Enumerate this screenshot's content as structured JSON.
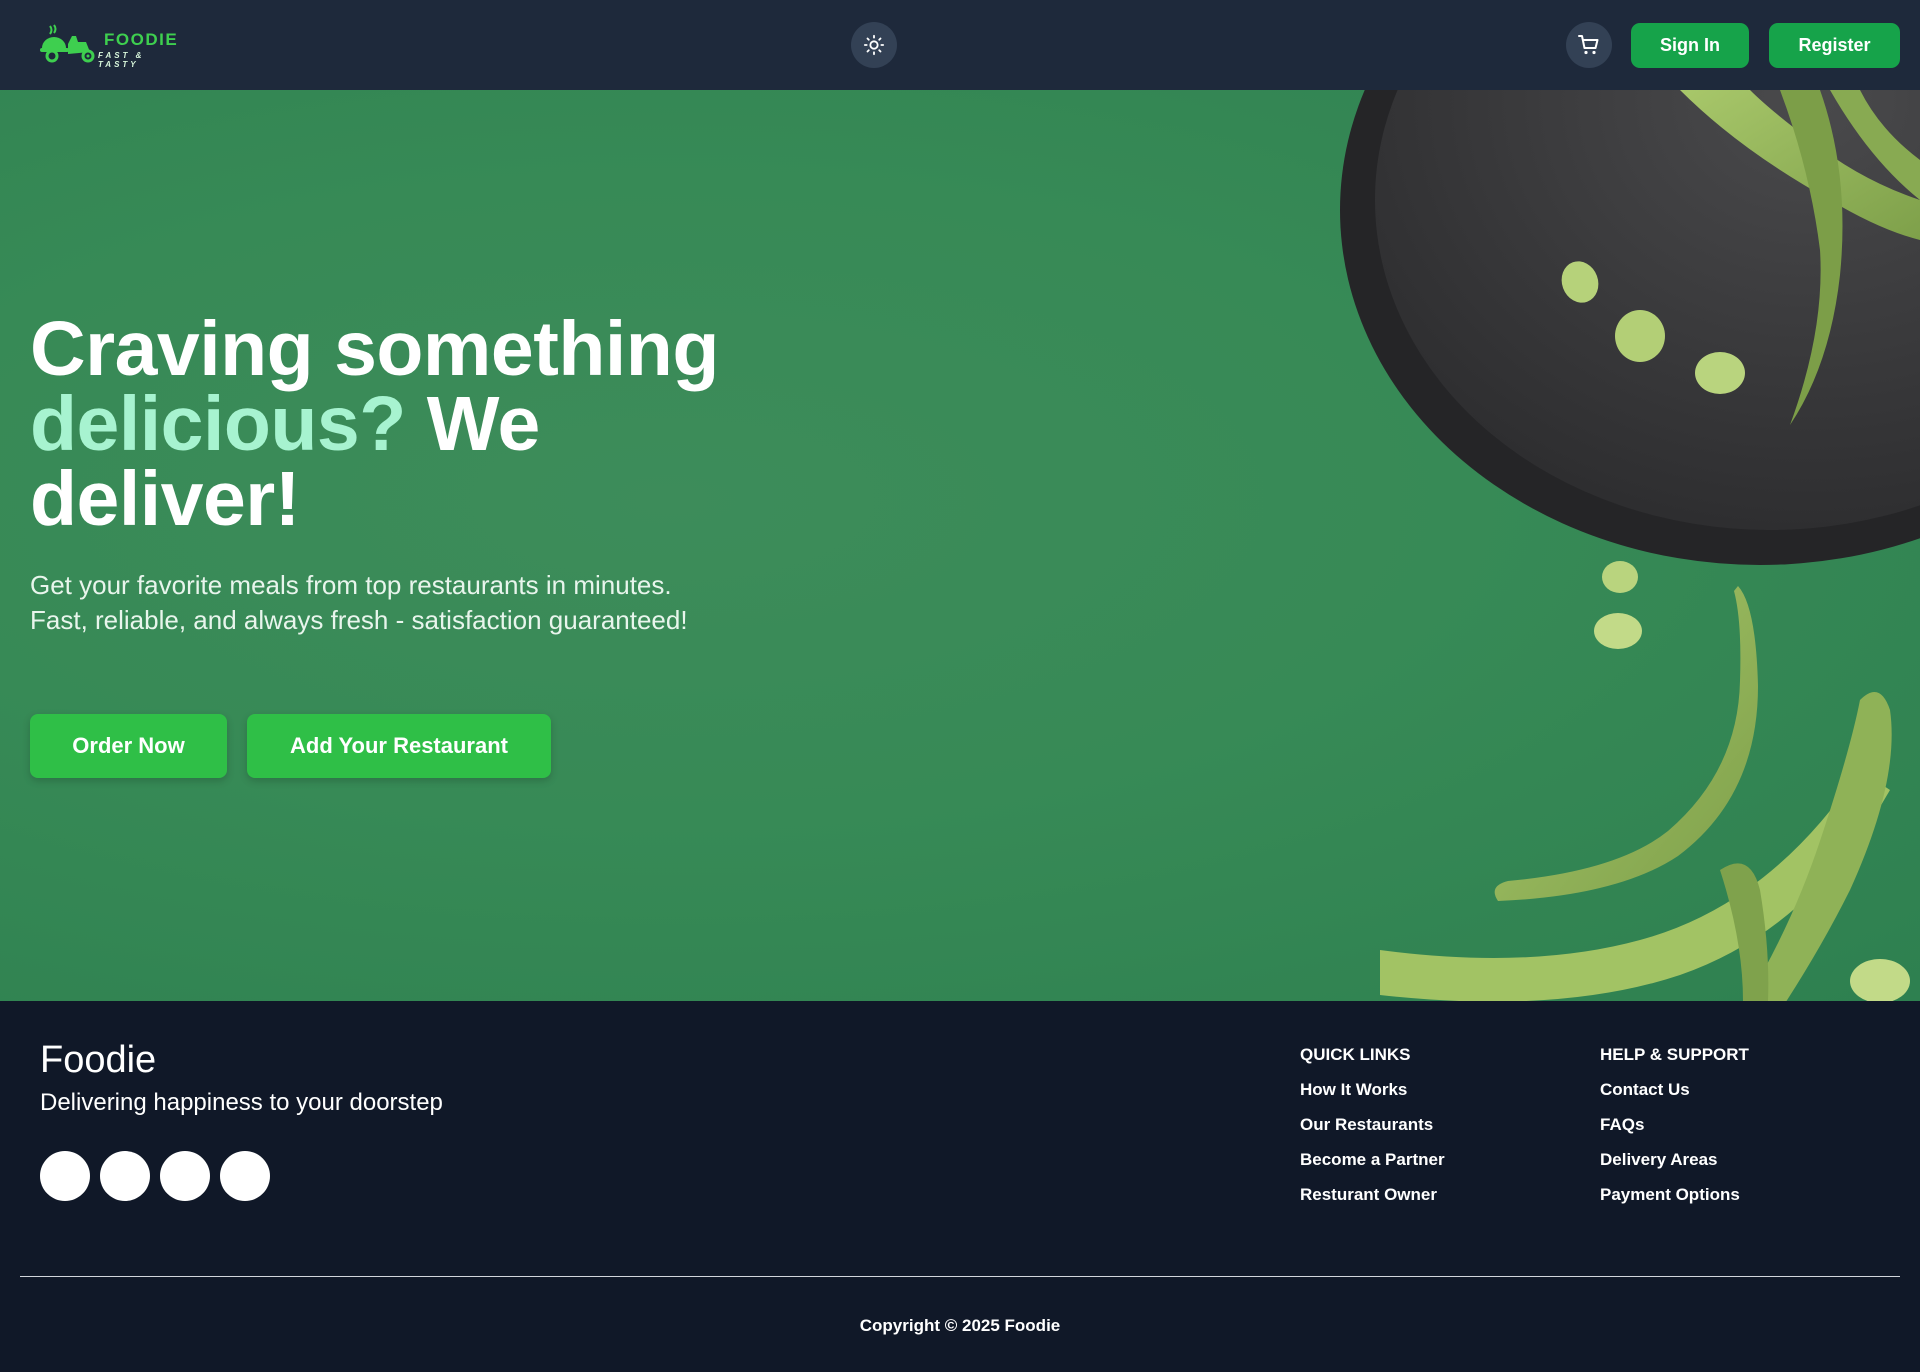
{
  "brand": {
    "name": "FOODIE",
    "tagline": "FAST & TASTY"
  },
  "nav": {
    "theme_icon": "sun-icon",
    "cart_icon": "shopping-cart-icon",
    "sign_in": "Sign In",
    "register": "Register"
  },
  "hero": {
    "title_line1": "Craving something",
    "title_accent": "delicious?",
    "title_after_accent": " We",
    "title_line3": "deliver!",
    "subtitle": "Get your favorite meals from top restaurants in minutes. Fast, reliable, and always fresh - satisfaction guaranteed!",
    "order_now": "Order Now",
    "add_restaurant": "Add Your Restaurant"
  },
  "footer": {
    "brand": "Foodie",
    "tagline": "Delivering happiness to your doorstep",
    "social_count": 4,
    "quick_links": {
      "heading": "QUICK LINKS",
      "items": [
        "How It Works",
        "Our Restaurants",
        "Become a Partner",
        "Resturant Owner"
      ]
    },
    "help_support": {
      "heading": "HELP & SUPPORT",
      "items": [
        "Contact Us",
        "FAQs",
        "Delivery Areas",
        "Payment Options"
      ]
    },
    "copyright": "Copyright © 2025 Foodie"
  },
  "colors": {
    "nav_bg": "#1e293b",
    "hero_bg": "#378a56",
    "accent_text": "#a7f3d0",
    "button_green": "#16a34a",
    "cta_green": "#2fbf47",
    "footer_bg": "#101828"
  }
}
